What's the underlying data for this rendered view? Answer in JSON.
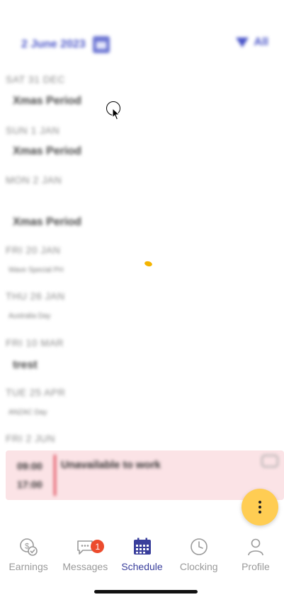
{
  "header": {
    "date_label": "2 June 2023",
    "filter_label": "All"
  },
  "schedule": [
    {
      "day": "SAT 31 DEC",
      "title": "Xmas Period",
      "subtitle": ""
    },
    {
      "day": "SUN 1 JAN",
      "title": "Xmas Period",
      "subtitle": ""
    },
    {
      "day": "MON 2 JAN",
      "title": "Xmas Period",
      "subtitle": ""
    },
    {
      "day": "FRI 20 JAN",
      "title": "",
      "subtitle": "Wave Special PH"
    },
    {
      "day": "THU 26 JAN",
      "title": "",
      "subtitle": "Australia Day"
    },
    {
      "day": "FRI 10 MAR",
      "title": "trest",
      "subtitle": ""
    },
    {
      "day": "TUE 25 APR",
      "title": "",
      "subtitle": "ANZAC Day"
    },
    {
      "day": "FRI 2 JUN",
      "title": "",
      "subtitle": ""
    }
  ],
  "unavailable": {
    "start": "09:00",
    "end": "17:00",
    "title": "Unavailable to work"
  },
  "nav": {
    "items": [
      {
        "label": "Earnings"
      },
      {
        "label": "Messages",
        "badge": "1"
      },
      {
        "label": "Schedule"
      },
      {
        "label": "Clocking"
      },
      {
        "label": "Profile"
      }
    ]
  },
  "colors": {
    "accent": "#3a3f9c",
    "fab": "#ffcd53",
    "unavailable_bg": "#fbe3e6",
    "badge": "#ec4b2d"
  }
}
